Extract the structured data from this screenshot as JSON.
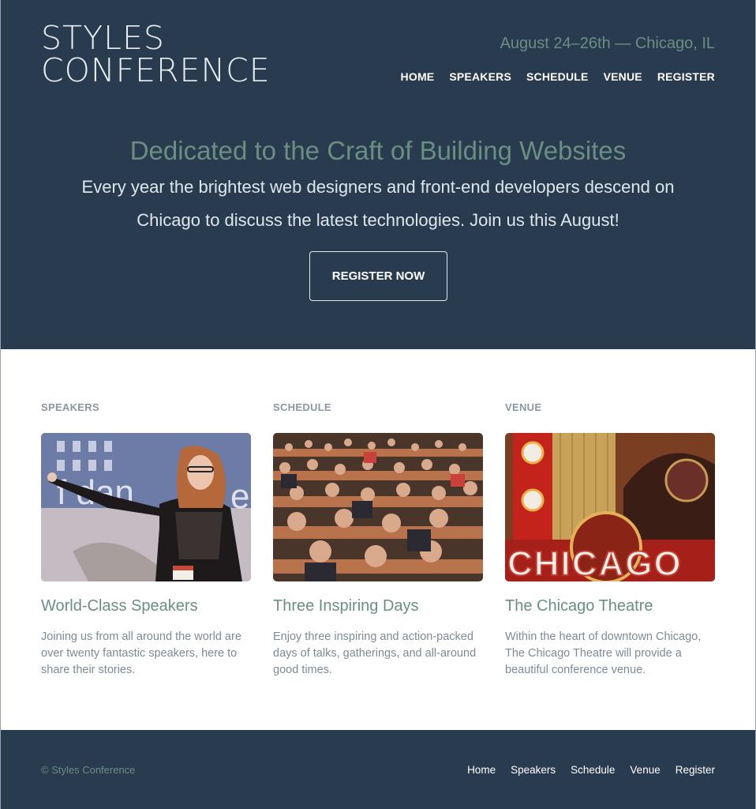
{
  "header": {
    "logo_line1": "STYLES",
    "logo_line2": "CONFERENCE",
    "tagline": "August 24–26th — Chicago, IL",
    "nav": [
      "HOME",
      "SPEAKERS",
      "SCHEDULE",
      "VENUE",
      "REGISTER"
    ]
  },
  "hero": {
    "title": "Dedicated to the Craft of Building Websites",
    "text": "Every year the brightest web designers and front-end developers descend on Chicago to discuss the latest technologies. Join us this August!",
    "button": "REGISTER NOW"
  },
  "columns": [
    {
      "label": "SPEAKERS",
      "title": "World-Class Speakers",
      "text": "Joining us from all around the world are over twenty fantastic speakers, here to share their stories.",
      "image": "speaker-photo"
    },
    {
      "label": "SCHEDULE",
      "title": "Three Inspiring Days",
      "text": "Enjoy three inspiring and action-packed days of talks, gatherings, and all-around good times.",
      "image": "audience-photo"
    },
    {
      "label": "VENUE",
      "title": "The Chicago Theatre",
      "text": "Within the heart of downtown Chicago, The Chicago Theatre will provide a beautiful conference venue.",
      "image": "chicago-theatre-sign-photo",
      "sign_text": "CHICAGO"
    }
  ],
  "footer": {
    "copyright": "© Styles Conference",
    "nav": [
      "Home",
      "Speakers",
      "Schedule",
      "Venue",
      "Register"
    ]
  },
  "colors": {
    "navy": "#293b4f",
    "green_accent": "#6b8e83",
    "body_text": "#7e8a95"
  }
}
